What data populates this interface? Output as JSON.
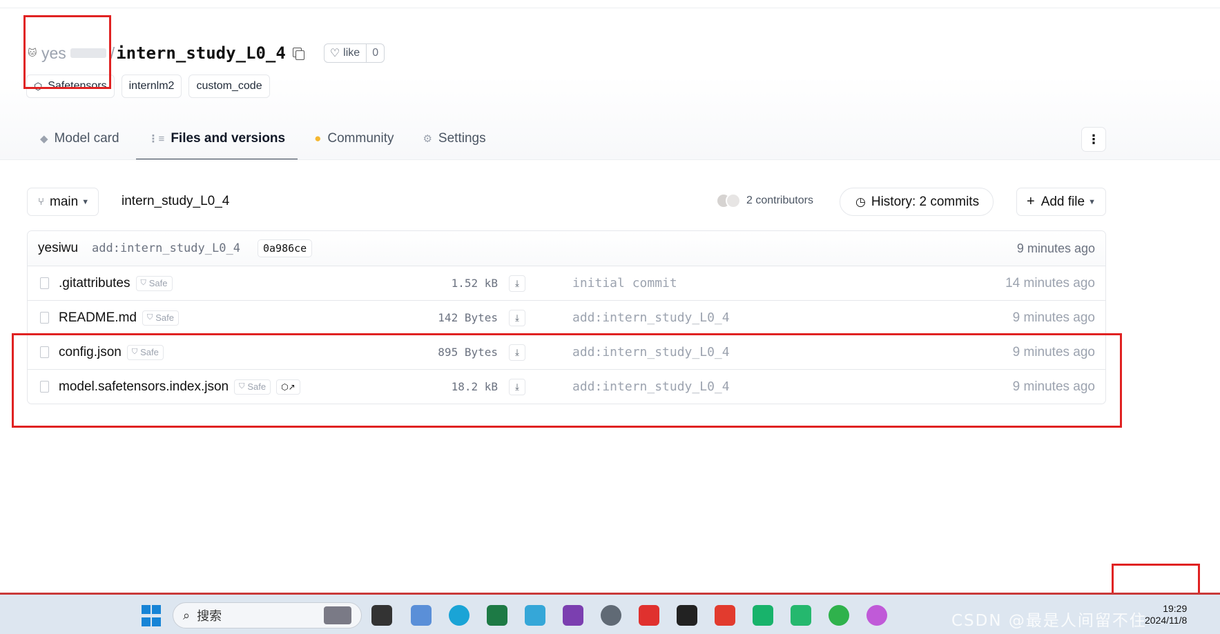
{
  "header": {
    "owner": "yes",
    "repo_name": "intern_study_L0_4",
    "like_label": "like",
    "like_count": "0"
  },
  "tags": [
    {
      "label": "Safetensors"
    },
    {
      "label": "internlm2"
    },
    {
      "label": "custom_code"
    }
  ],
  "tabs": [
    {
      "label": "Model card",
      "active": false
    },
    {
      "label": "Files and versions",
      "active": true
    },
    {
      "label": "Community",
      "active": false
    },
    {
      "label": "Settings",
      "active": false
    }
  ],
  "toolbar": {
    "branch": "main",
    "path": "intern_study_L0_4",
    "contributors": "2 contributors",
    "history": "History: 2 commits",
    "add_file": "Add file"
  },
  "last_commit": {
    "user": "yesiwu",
    "message": "add:intern_study_L0_4",
    "sha": "0a986ce",
    "time": "9 minutes ago"
  },
  "files": [
    {
      "name": ".gitattributes",
      "safe": "Safe",
      "size": "1.52 kB",
      "message": "initial commit",
      "time": "14 minutes ago"
    },
    {
      "name": "README.md",
      "safe": "Safe",
      "size": "142 Bytes",
      "message": "add:intern_study_L0_4",
      "time": "9 minutes ago"
    },
    {
      "name": "config.json",
      "safe": "Safe",
      "size": "895 Bytes",
      "message": "add:intern_study_L0_4",
      "time": "9 minutes ago"
    },
    {
      "name": "model.safetensors.index.json",
      "safe": "Safe",
      "size": "18.2 kB",
      "message": "add:intern_study_L0_4",
      "time": "9 minutes ago"
    }
  ],
  "taskbar": {
    "search_placeholder": "搜索",
    "watermark": "CSDN @最是人间留不住",
    "clock_time": "19:29",
    "clock_date": "2024/11/8"
  },
  "colors": {
    "annotation_red": "#e02222",
    "accent_blue": "#1784d6"
  }
}
